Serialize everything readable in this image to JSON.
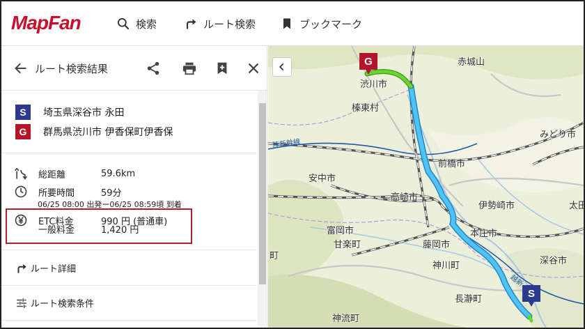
{
  "header": {
    "logo_text": "MapFan",
    "nav": {
      "search_label": "検索",
      "route_search_label": "ルート検索",
      "bookmark_label": "ブックマーク"
    }
  },
  "panel": {
    "title": "ルート検索結果",
    "start": {
      "badge": "S",
      "name": "埼玉県深谷市 永田"
    },
    "goal": {
      "badge": "G",
      "name": "群馬県渋川市 伊香保町伊香保"
    },
    "summary": {
      "distance_label": "総距離",
      "distance_value": "59.6km",
      "time_label": "所要時間",
      "time_value": "59分",
      "time_detail": "06/25 08:00 出発ー06/25 08:59頃 到着",
      "etc_label": "ETC料金",
      "etc_value": "990 円 (普通車)",
      "normal_label": "一般料金",
      "normal_value": "1,420 円"
    },
    "links": {
      "detail": "ルート詳細",
      "conditions": "ルート検索条件"
    }
  },
  "map": {
    "labels": {
      "akagi": "赤城山",
      "shibukawa": "渋川市",
      "shinto": "榛東村",
      "rikushinkansen": "陸新幹線",
      "midori": "みどり市",
      "maebashi": "前橋市",
      "annaka": "安中市",
      "takasaki": "高崎市",
      "isesaki": "伊勢崎市",
      "ota": "太田",
      "tomioka": "富岡市",
      "kanra": "甘楽町",
      "honjo": "本庄市",
      "fukaya": "深谷市",
      "fujioka": "藤岡市",
      "kamikawa": "神川町",
      "town_left": "町",
      "nagatoro": "長瀞町",
      "kamiizumi": "神流町",
      "joetsu": "越新"
    },
    "goal_badge": "G",
    "start_badge": "S",
    "route_color": "#4fc3f7",
    "route_end_color": "#6cd431"
  }
}
